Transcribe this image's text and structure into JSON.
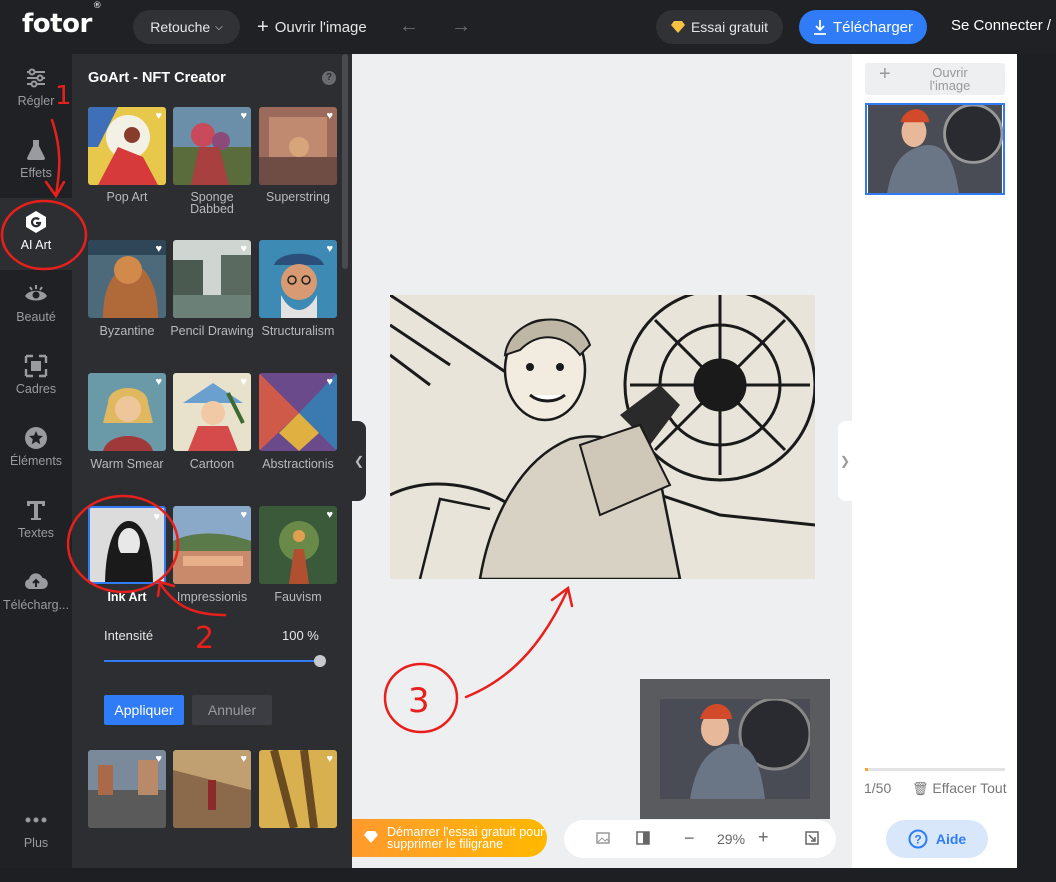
{
  "header": {
    "logo": "fotor",
    "logo_mark": "®",
    "mode": "Retouche",
    "open_image": "Ouvrir l'image",
    "trial": "Essai gratuit",
    "download": "Télécharger",
    "login": "Se Connecter /"
  },
  "nav": [
    {
      "label": "Régler",
      "icon": "sliders-icon"
    },
    {
      "label": "Effets",
      "icon": "flask-icon"
    },
    {
      "label": "AI Art",
      "icon": "ai-art-icon"
    },
    {
      "label": "Beauté",
      "icon": "eye-icon"
    },
    {
      "label": "Cadres",
      "icon": "frame-icon"
    },
    {
      "label": "Éléments",
      "icon": "star-icon"
    },
    {
      "label": "Textes",
      "icon": "text-icon"
    },
    {
      "label": "Télécharg...",
      "icon": "upload-cloud-icon"
    },
    {
      "label": "Plus",
      "icon": "more-dots-icon"
    }
  ],
  "panel": {
    "title": "GoArt - NFT Creator",
    "styles": [
      {
        "label": "Pop Art"
      },
      {
        "label": "Sponge Dabbed"
      },
      {
        "label": "Superstring"
      },
      {
        "label": "Byzantine"
      },
      {
        "label": "Pencil Drawing"
      },
      {
        "label": "Structuralism"
      },
      {
        "label": "Warm Smear"
      },
      {
        "label": "Cartoon"
      },
      {
        "label": "Abstractionis"
      },
      {
        "label": "Ink Art"
      },
      {
        "label": "Impressionis"
      },
      {
        "label": "Fauvism"
      }
    ],
    "selected": "Ink Art",
    "intensity_label": "Intensité",
    "intensity_value": "100 %",
    "intensity": 1.0,
    "apply": "Appliquer",
    "cancel": "Annuler"
  },
  "canvas": {
    "trial_banner": "Démarrer l'essai gratuit pour supprimer le filigrane",
    "zoom": "29%"
  },
  "right": {
    "open_image": "Ouvrir l'image",
    "count": "1/50",
    "clear": "Effacer Tout",
    "help": "Aide"
  },
  "annotations": [
    "1",
    "2",
    "3"
  ],
  "colors": {
    "accent": "#2f7cf6",
    "annotation": "#e8201c",
    "dark": "#202124",
    "panel": "#2d2e32"
  }
}
